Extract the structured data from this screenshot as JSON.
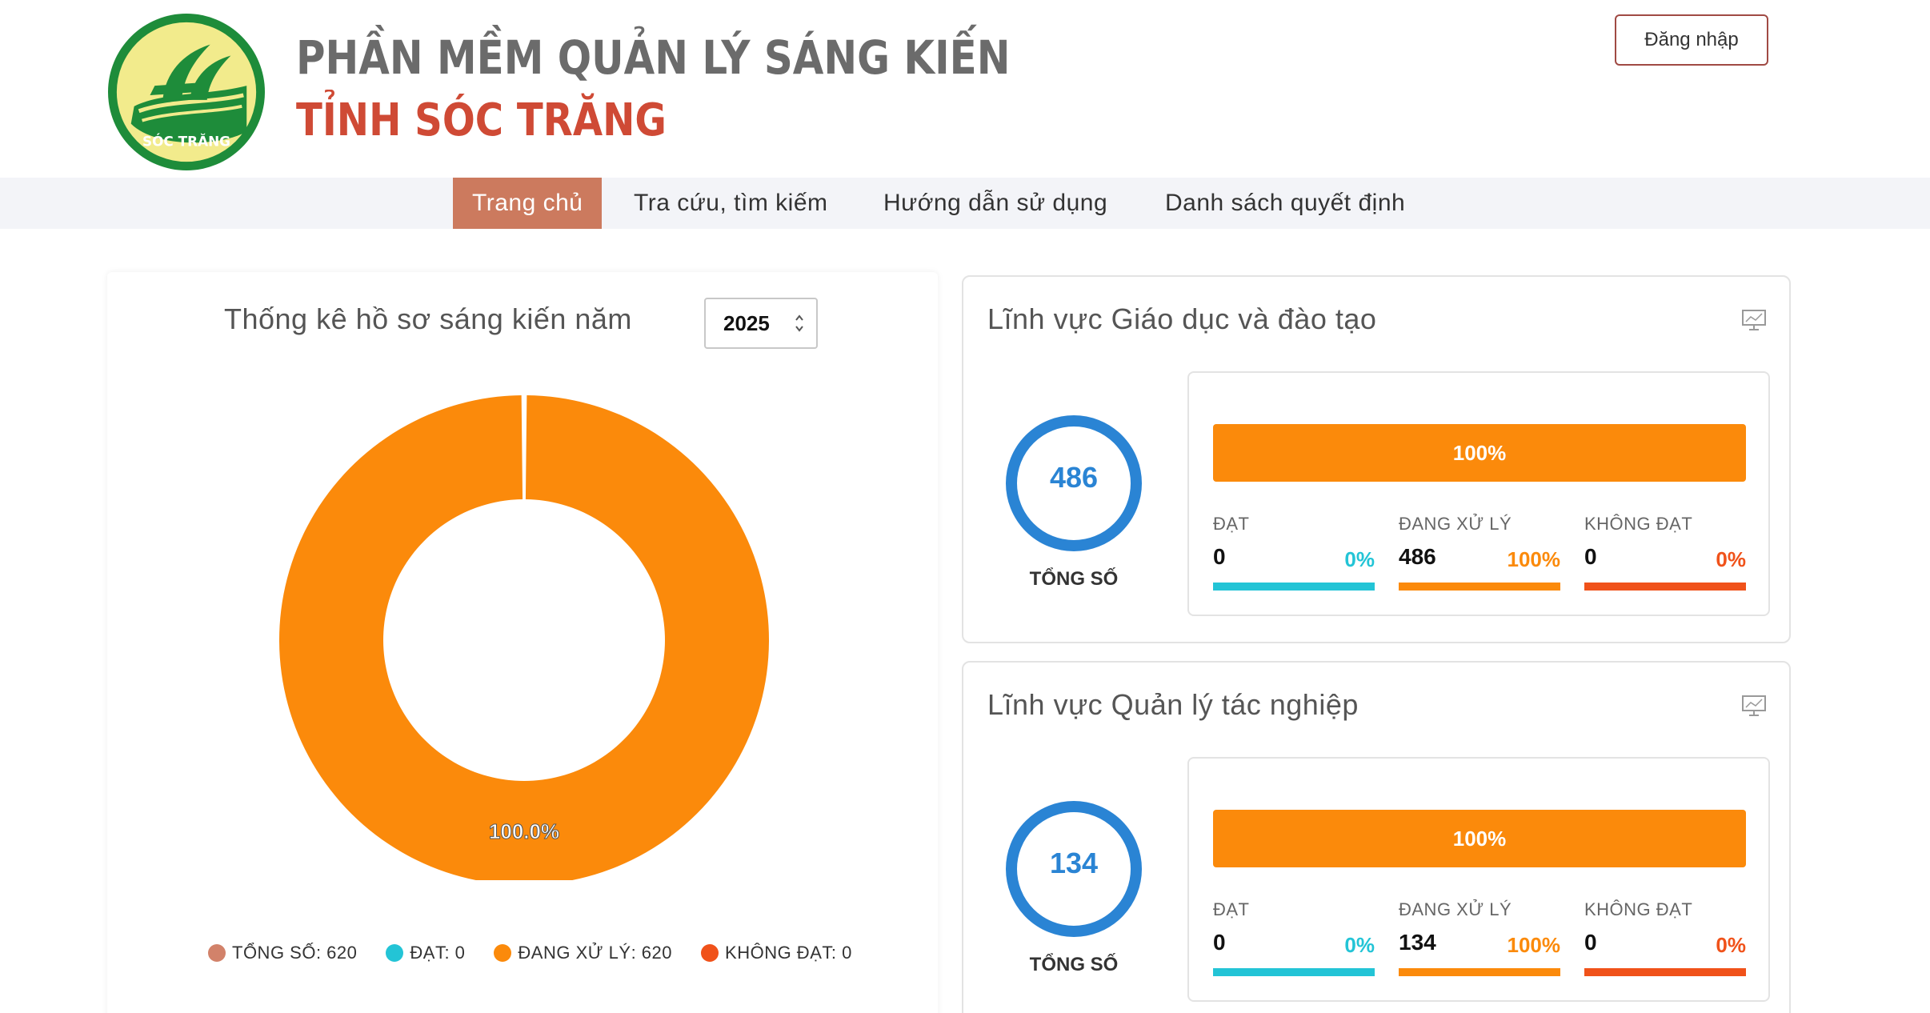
{
  "header": {
    "logo_text": "SÓC TRĂNG",
    "title_line1": "PHẦN MỀM QUẢN LÝ SÁNG KIẾN",
    "title_line2": "TỈNH SÓC TRĂNG",
    "login_label": "Đăng nhập"
  },
  "nav": {
    "items": [
      {
        "label": "Trang chủ",
        "active": true
      },
      {
        "label": "Tra cứu, tìm kiếm",
        "active": false
      },
      {
        "label": "Hướng dẫn sử dụng",
        "active": false
      },
      {
        "label": "Danh sách quyết định",
        "active": false
      }
    ]
  },
  "overview": {
    "title": "Thống kê hồ sơ sáng kiến năm",
    "year": "2025",
    "legend": [
      {
        "label": "TỔNG SỐ: 620",
        "color": "#d2826a"
      },
      {
        "label": "ĐẠT: 0",
        "color": "#23c4d6"
      },
      {
        "label": "ĐANG XỬ LÝ: 620",
        "color": "#fb8a0b"
      },
      {
        "label": "KHÔNG ĐẠT: 0",
        "color": "#f0521a"
      }
    ]
  },
  "chart_data": {
    "type": "pie",
    "title": "",
    "slices": [
      {
        "label": "ĐẠT",
        "value": 0,
        "color": "#23c4d6"
      },
      {
        "label": "ĐANG XỬ LÝ",
        "value": 620,
        "color": "#fb8a0b"
      },
      {
        "label": "KHÔNG ĐẠT",
        "value": 0,
        "color": "#f0521a"
      }
    ],
    "data_labels": [
      "100.0%"
    ],
    "legend_position": "bottom"
  },
  "fields": [
    {
      "title": "Lĩnh vực Giáo dục và đào tạo",
      "total": "486",
      "total_label": "TỔNG SỐ",
      "bar_label": "100%",
      "stats": [
        {
          "label": "ĐẠT",
          "count": "0",
          "pct": "0%",
          "color": "#23c4d6"
        },
        {
          "label": "ĐANG XỬ LÝ",
          "count": "486",
          "pct": "100%",
          "color": "#fb8a0b"
        },
        {
          "label": "KHÔNG ĐẠT",
          "count": "0",
          "pct": "0%",
          "color": "#f0521a"
        }
      ]
    },
    {
      "title": "Lĩnh vực Quản lý tác nghiệp",
      "total": "134",
      "total_label": "TỔNG SỐ",
      "bar_label": "100%",
      "stats": [
        {
          "label": "ĐẠT",
          "count": "0",
          "pct": "0%",
          "color": "#23c4d6"
        },
        {
          "label": "ĐANG XỬ LÝ",
          "count": "134",
          "pct": "100%",
          "color": "#fb8a0b"
        },
        {
          "label": "KHÔNG ĐẠT",
          "count": "0",
          "pct": "0%",
          "color": "#f0521a"
        }
      ]
    }
  ],
  "colors": {
    "accent": "#cc7a5e",
    "ring": "#2a84d4",
    "title_red": "#cf4a35"
  }
}
